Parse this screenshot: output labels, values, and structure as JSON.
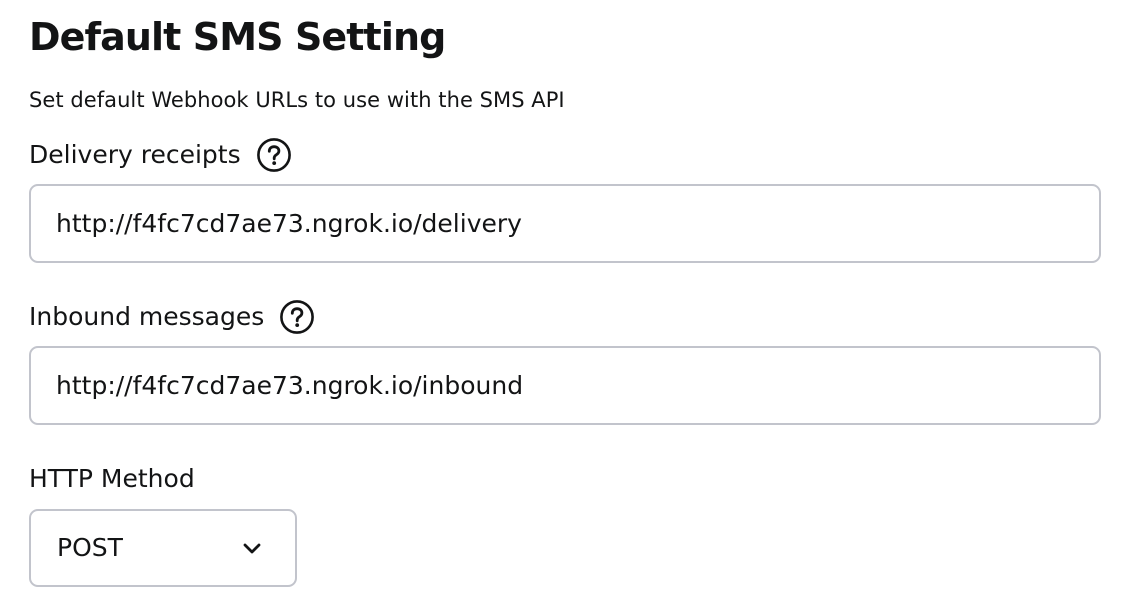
{
  "page": {
    "title": "Default SMS Setting",
    "description": "Set default Webhook URLs to use with the SMS API"
  },
  "delivery_receipts": {
    "label": "Delivery receipts",
    "help_icon": "question-circle-icon",
    "value": "http://f4fc7cd7ae73.ngrok.io/delivery"
  },
  "inbound_messages": {
    "label": "Inbound messages",
    "help_icon": "question-circle-icon",
    "value": "http://f4fc7cd7ae73.ngrok.io/inbound"
  },
  "http_method": {
    "label": "HTTP Method",
    "selected": "POST",
    "dropdown_icon": "chevron-down-icon"
  },
  "colors": {
    "text": "#131415",
    "border": "#c2c4cc",
    "background": "#ffffff"
  }
}
